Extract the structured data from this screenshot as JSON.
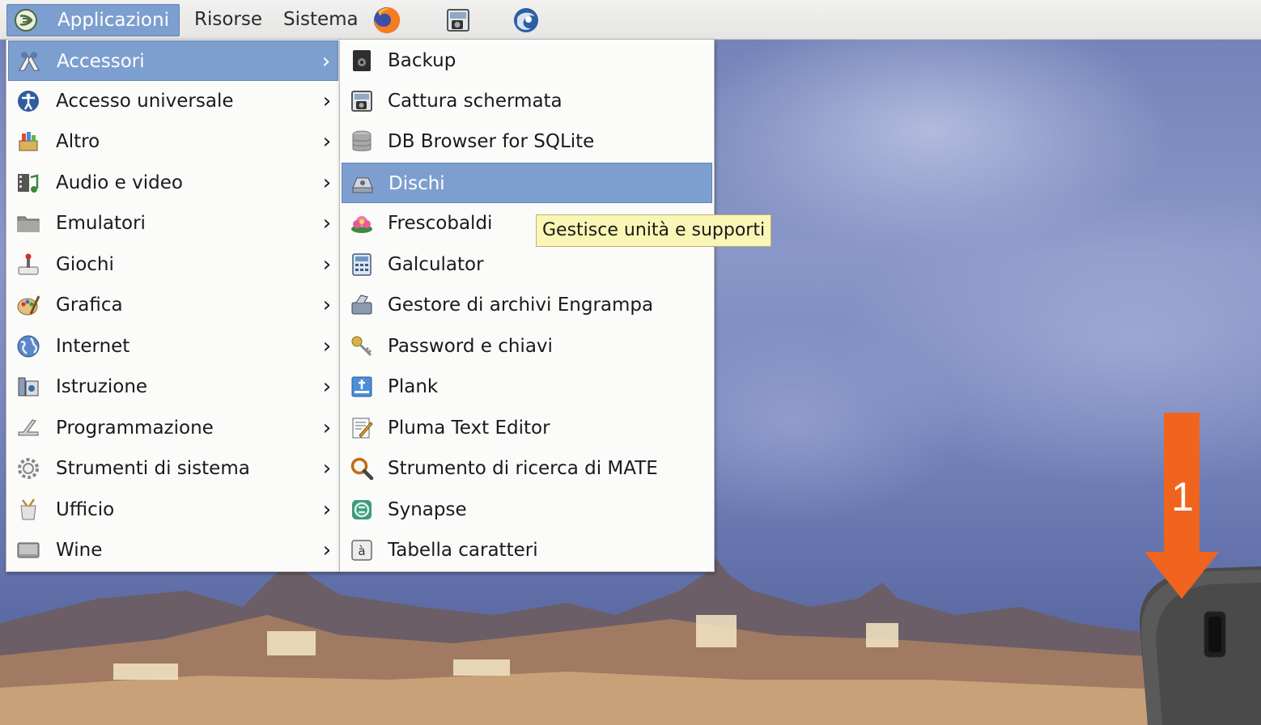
{
  "panel": {
    "applications_label": "Applicazioni",
    "places_label": "Risorse",
    "system_label": "Sistema",
    "launchers": [
      "firefox-icon",
      "screenshot-icon",
      "thunderbird-icon"
    ]
  },
  "applications_menu": {
    "items": [
      {
        "label": "Accessori",
        "icon": "accessories-icon",
        "selected": true
      },
      {
        "label": "Accesso universale",
        "icon": "accessibility-icon"
      },
      {
        "label": "Altro",
        "icon": "other-icon"
      },
      {
        "label": "Audio e video",
        "icon": "multimedia-icon"
      },
      {
        "label": "Emulatori",
        "icon": "folder-icon"
      },
      {
        "label": "Giochi",
        "icon": "games-icon"
      },
      {
        "label": "Grafica",
        "icon": "graphics-icon"
      },
      {
        "label": "Internet",
        "icon": "internet-icon"
      },
      {
        "label": "Istruzione",
        "icon": "education-icon"
      },
      {
        "label": "Programmazione",
        "icon": "programming-icon"
      },
      {
        "label": "Strumenti di sistema",
        "icon": "system-tools-icon"
      },
      {
        "label": "Ufficio",
        "icon": "office-icon"
      },
      {
        "label": "Wine",
        "icon": "wine-icon"
      }
    ]
  },
  "accessories_menu": {
    "items": [
      {
        "label": "Backup",
        "icon": "backup-icon"
      },
      {
        "label": "Cattura schermata",
        "icon": "screenshot-icon"
      },
      {
        "label": "DB Browser for SQLite",
        "icon": "database-icon"
      },
      {
        "label": "Dischi",
        "icon": "disks-icon",
        "selected": true
      },
      {
        "label": "Frescobaldi",
        "icon": "frescobaldi-icon"
      },
      {
        "label": "Galculator",
        "icon": "calculator-icon"
      },
      {
        "label": "Gestore di archivi Engrampa",
        "icon": "archive-icon"
      },
      {
        "label": "Password e chiavi",
        "icon": "keys-icon"
      },
      {
        "label": "Plank",
        "icon": "plank-icon"
      },
      {
        "label": "Pluma Text Editor",
        "icon": "text-editor-icon"
      },
      {
        "label": "Strumento di ricerca di MATE",
        "icon": "search-icon"
      },
      {
        "label": "Synapse",
        "icon": "synapse-icon"
      },
      {
        "label": "Tabella caratteri",
        "icon": "character-map-icon"
      }
    ]
  },
  "tooltip": "Gestisce unità e supporti",
  "annotation": {
    "number": "1",
    "color": "#f0641e"
  },
  "colors": {
    "selection": "#7d9fcf",
    "tooltip_bg": "#f9f6b6"
  }
}
